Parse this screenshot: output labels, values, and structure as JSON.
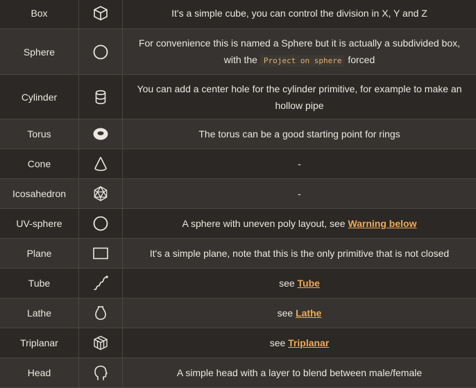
{
  "rows": [
    {
      "name": "Box",
      "icon": "cube-icon",
      "desc_before": "It's a simple cube, you can control the division in X, Y and Z"
    },
    {
      "name": "Sphere",
      "icon": "circle-icon",
      "desc_before": "For convenience this is named a Sphere but it is actually a subdivided box, with the",
      "code": "Project on sphere",
      "desc_after": "forced"
    },
    {
      "name": "Cylinder",
      "icon": "cylinder-icon",
      "desc_before": "You can add a center hole for the cylinder primitive, for example to make an hollow pipe"
    },
    {
      "name": "Torus",
      "icon": "torus-icon",
      "desc_before": "The torus can be a good starting point for rings"
    },
    {
      "name": "Cone",
      "icon": "cone-icon",
      "desc_before": "-"
    },
    {
      "name": "Icosahedron",
      "icon": "icosahedron-icon",
      "desc_before": "-"
    },
    {
      "name": "UV-sphere",
      "icon": "circle-icon",
      "desc_before": "A sphere with uneven poly layout, see",
      "link": "Warning below"
    },
    {
      "name": "Plane",
      "icon": "rectangle-icon",
      "desc_before": "It's a simple plane, note that this is the only primitive that is not closed"
    },
    {
      "name": "Tube",
      "icon": "curve-icon",
      "desc_before": "see",
      "link": "Tube"
    },
    {
      "name": "Lathe",
      "icon": "vase-icon",
      "desc_before": "see",
      "link": "Lathe"
    },
    {
      "name": "Triplanar",
      "icon": "triplanar-cube-icon",
      "desc_before": "see",
      "link": "Triplanar"
    },
    {
      "name": "Head",
      "icon": "head-icon",
      "desc_before": "A simple head with a layer to blend between male/female"
    }
  ]
}
